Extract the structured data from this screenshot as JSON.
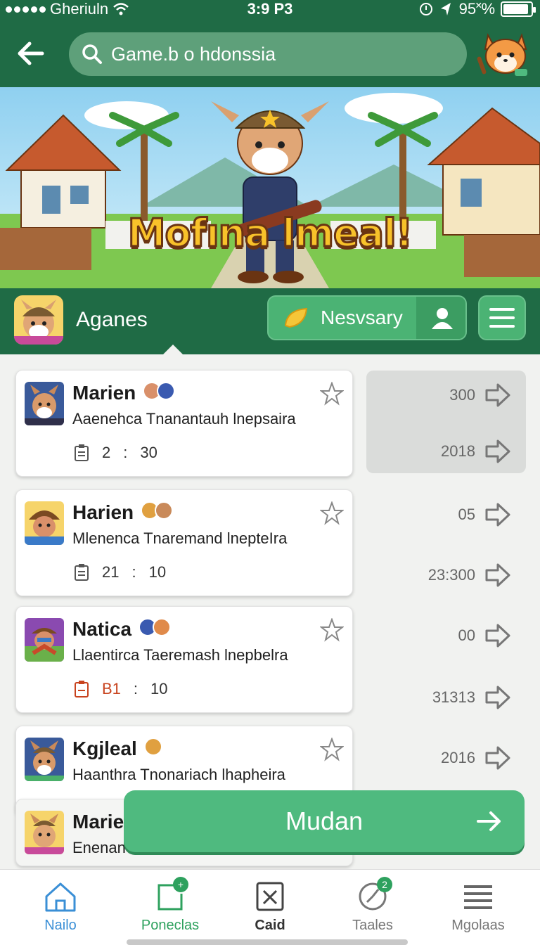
{
  "status_bar": {
    "carrier": "Gheriuln",
    "time": "3:9 P3",
    "battery": "95˟%",
    "battery_level": 0.92
  },
  "search": {
    "placeholder": "Game.b o hdonssia"
  },
  "banner": {
    "title": "Mofına lmeal!"
  },
  "app_header": {
    "name": "Aganes",
    "pill_label": "Nesvsary"
  },
  "cards": [
    {
      "title": "Marien",
      "subtitle": "Aaenehca Tnanantauh lnepsaira",
      "meta_hours": "2",
      "meta_minutes": "30",
      "meta_color": "#555555"
    },
    {
      "title": "Harien",
      "subtitle": "Mlenenca Tnaremand lnepteIra",
      "meta_hours": "21",
      "meta_minutes": "10",
      "meta_color": "#555555"
    },
    {
      "title": "Natica",
      "subtitle": "Llaentirca Taeremash lnepbelra",
      "meta_hours": "B1",
      "meta_minutes": "10",
      "meta_color": "#c8431e"
    },
    {
      "title": "Kgjleal",
      "subtitle": "Haanthra Tnonariach lhapheira"
    },
    {
      "title": "Marie",
      "subtitle": "Enenan"
    }
  ],
  "side_values": [
    "300",
    "2018",
    "05",
    "23:300",
    "00",
    "31313",
    "2016"
  ],
  "cta": {
    "label": "Mudan"
  },
  "bottom_nav": [
    {
      "label": "Nailo",
      "icon": "home-icon",
      "color": "#3a8fd6"
    },
    {
      "label": "Poneclas",
      "icon": "new-post-icon",
      "color": "#2ea15e",
      "badge": ""
    },
    {
      "label": "Caid",
      "icon": "card-icon",
      "color": "#444444"
    },
    {
      "label": "Taales",
      "icon": "clock-icon",
      "color": "#777777",
      "badge": "2"
    },
    {
      "label": "Mgolaas",
      "icon": "menu-icon",
      "color": "#777777"
    }
  ],
  "colors": {
    "primary": "#1f6b45",
    "accent": "#4fba7f",
    "search_bg": "#5ea07a"
  }
}
